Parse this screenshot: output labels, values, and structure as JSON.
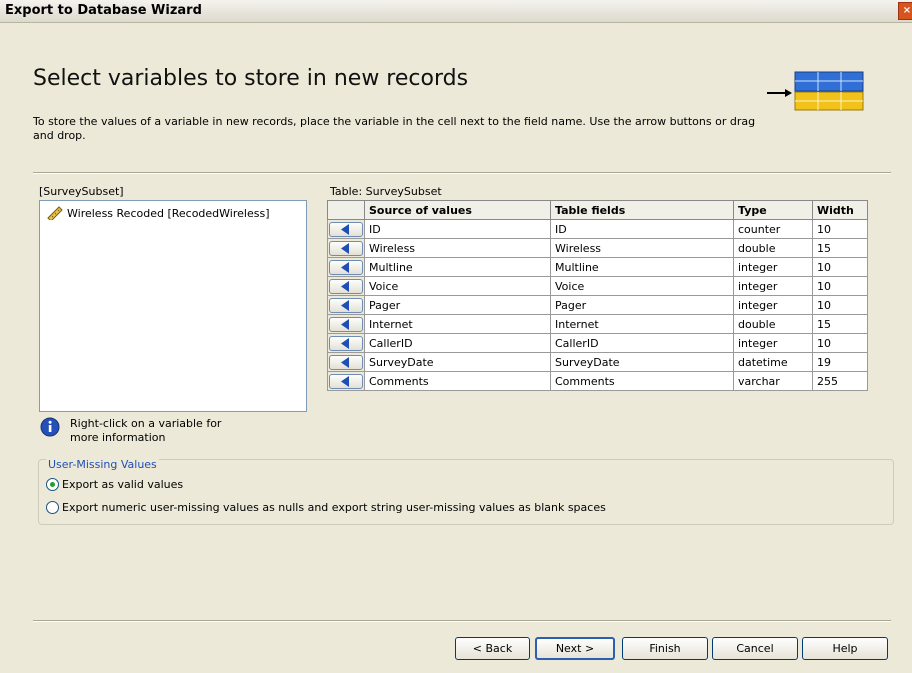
{
  "window": {
    "title": "Export to Database Wizard",
    "close_glyph": "×"
  },
  "header": {
    "heading": "Select variables to store in new records",
    "description": "To store the values of a variable in new records, place the variable in the cell next to the field name. Use the arrow buttons or drag and drop.",
    "graphic_icon": "arrow-into-table-icon",
    "colors": {
      "top_table": "#2f6fd6",
      "bottom_table": "#f2c21b"
    }
  },
  "source_panel": {
    "label": "[SurveySubset]",
    "items": [
      {
        "icon": "ruler-variable-icon",
        "label": "Wireless Recoded [RecodedWireless]"
      }
    ]
  },
  "table_panel": {
    "label": "Table: SurveySubset",
    "columns": [
      "",
      "Source of values",
      "Table fields",
      "Type",
      "Width"
    ],
    "rows": [
      {
        "source": "ID",
        "field": "ID",
        "type": "counter",
        "width": "10"
      },
      {
        "source": "Wireless",
        "field": "Wireless",
        "type": "double",
        "width": "15"
      },
      {
        "source": "Multline",
        "field": "Multline",
        "type": "integer",
        "width": "10"
      },
      {
        "source": "Voice",
        "field": "Voice",
        "type": "integer",
        "width": "10"
      },
      {
        "source": "Pager",
        "field": "Pager",
        "type": "integer",
        "width": "10"
      },
      {
        "source": "Internet",
        "field": "Internet",
        "type": "double",
        "width": "15"
      },
      {
        "source": "CallerID",
        "field": "CallerID",
        "type": "integer",
        "width": "10"
      },
      {
        "source": "SurveyDate",
        "field": "SurveyDate",
        "type": "datetime",
        "width": "19"
      },
      {
        "source": "Comments",
        "field": "Comments",
        "type": "varchar",
        "width": "255"
      }
    ]
  },
  "info": {
    "icon": "info-icon",
    "text": "Right-click on a variable for more information"
  },
  "user_missing": {
    "legend": "User-Missing Values",
    "options": [
      {
        "label": "Export as valid values",
        "selected": true
      },
      {
        "label": "Export numeric user-missing values as nulls and export string user-missing values as blank spaces",
        "selected": false
      }
    ]
  },
  "buttons": {
    "back": "< Back",
    "next": "Next >",
    "finish": "Finish",
    "cancel": "Cancel",
    "help": "Help"
  }
}
